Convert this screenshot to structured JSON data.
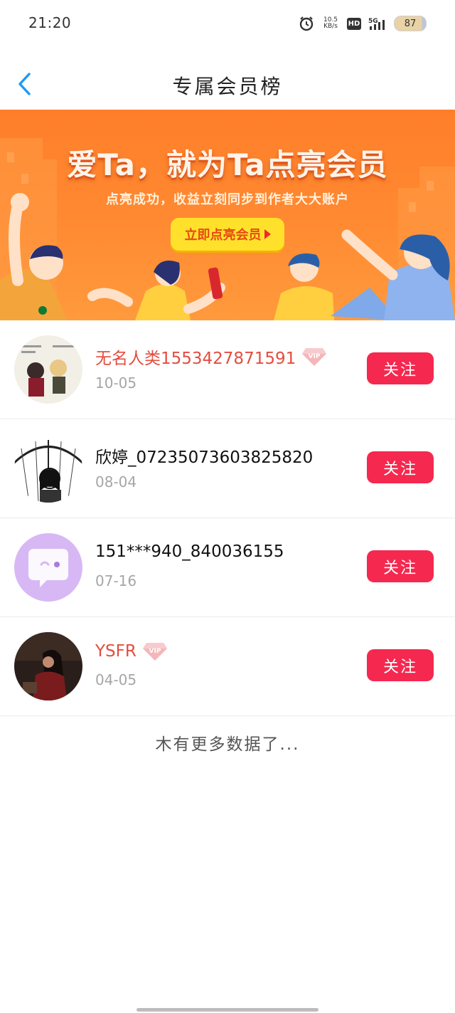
{
  "status_bar": {
    "time": "21:20",
    "net_speed_value": "10.5",
    "net_speed_unit": "KB/s",
    "hd_label": "HD",
    "network_label": "5G",
    "battery": "87",
    "battery_level_percent": 87
  },
  "header": {
    "back_icon": "chevron-left-icon",
    "title": "专属会员榜"
  },
  "banner": {
    "headline": "爱Ta，就为Ta点亮会员",
    "subline": "点亮成功，收益立刻同步到作者大大账户",
    "button_label": "立即点亮会员"
  },
  "members": [
    {
      "name": "无名人类1553427871591",
      "vip": true,
      "date": "10-05",
      "follow_label": "关注"
    },
    {
      "name": "欣婷_07235073603825820",
      "vip": false,
      "date": "08-04",
      "follow_label": "关注"
    },
    {
      "name": "151***940_840036155",
      "vip": false,
      "date": "07-16",
      "follow_label": "关注"
    },
    {
      "name": "YSFR",
      "vip": true,
      "date": "04-05",
      "follow_label": "关注"
    }
  ],
  "footer": {
    "no_more": "木有更多数据了..."
  },
  "colors": {
    "accent": "#f5284f",
    "vip_name": "#e34d3f",
    "back_icon": "#1e9af2",
    "banner_orange": "#ff8a31",
    "banner_button": "#ffe12c"
  }
}
